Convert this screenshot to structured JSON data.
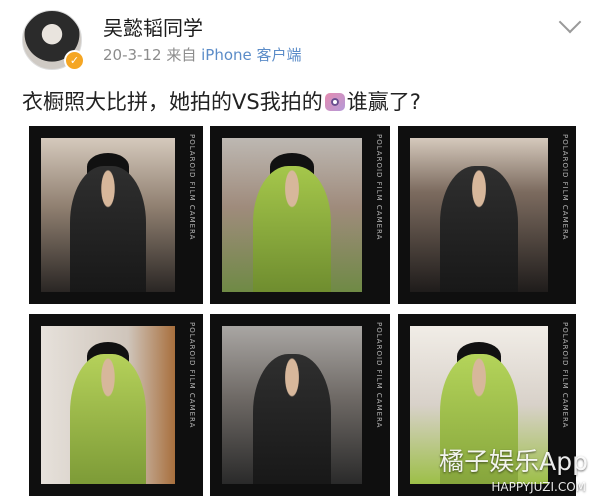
{
  "post": {
    "author": {
      "name": "吴懿韬同学"
    },
    "meta": {
      "date": "20-3-12",
      "source_prefix": "来自",
      "source": "iPhone 客户端"
    },
    "text": {
      "before_icon": "衣橱照大比拼，她拍的VS我拍的",
      "after_icon": "谁赢了?"
    }
  },
  "photos": [
    {
      "strip": "POLAROID FILM CAMERA"
    },
    {
      "strip": "POLAROID FILM CAMERA"
    },
    {
      "strip": "POLAROID FILM CAMERA"
    },
    {
      "strip": "POLAROID FILM CAMERA"
    },
    {
      "strip": "POLAROID FILM CAMERA"
    },
    {
      "strip": "POLAROID FILM CAMERA"
    }
  ],
  "watermark": {
    "brand": "橘子娱乐App",
    "url": "HAPPYJUZI.COM"
  }
}
